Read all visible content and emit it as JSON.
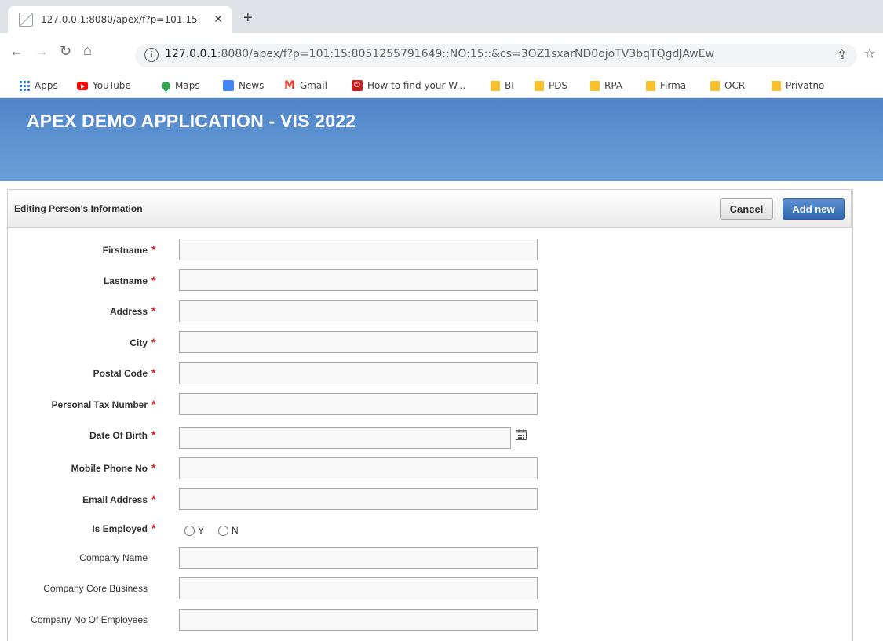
{
  "browser": {
    "tab_title": "127.0.0.1:8080/apex/f?p=101:15:",
    "tab_close": "✕",
    "new_tab": "+",
    "url_host": "127.0.0.1",
    "url_rest": ":8080/apex/f?p=101:15:8051255791649::NO:15::&cs=3OZ1sxarND0ojoTV3bqTQgdJAwEw",
    "bookmarks": [
      "Apps",
      "YouTube",
      "Maps",
      "News",
      "Gmail",
      "How to find your W...",
      "BI",
      "PDS",
      "RPA",
      "Firma",
      "OCR",
      "Privatno"
    ]
  },
  "app": {
    "title": "APEX DEMO APPLICATION - VIS 2022"
  },
  "region": {
    "title": "Editing Person's Information",
    "cancel_label": "Cancel",
    "add_label": "Add new"
  },
  "form": {
    "required_mark": "*",
    "fields": [
      {
        "label": "Firstname",
        "value": ""
      },
      {
        "label": "Lastname",
        "value": ""
      },
      {
        "label": "Address",
        "value": ""
      },
      {
        "label": "City",
        "value": ""
      },
      {
        "label": "Postal Code",
        "value": ""
      },
      {
        "label": "Personal Tax Number",
        "value": ""
      },
      {
        "label": "Date Of Birth",
        "value": ""
      },
      {
        "label": "Mobile Phone No",
        "value": ""
      },
      {
        "label": "Email Address",
        "value": ""
      },
      {
        "label": "Is Employed",
        "options": [
          "Y",
          "N"
        ]
      },
      {
        "label": "Company Name",
        "value": ""
      },
      {
        "label": "Company Core Business",
        "value": ""
      },
      {
        "label": "Company No Of Employees",
        "value": ""
      }
    ]
  },
  "colors": {
    "header_blue": "#4f85c9",
    "required_red": "#d81b1b",
    "primary_button": "#2f67b1"
  }
}
